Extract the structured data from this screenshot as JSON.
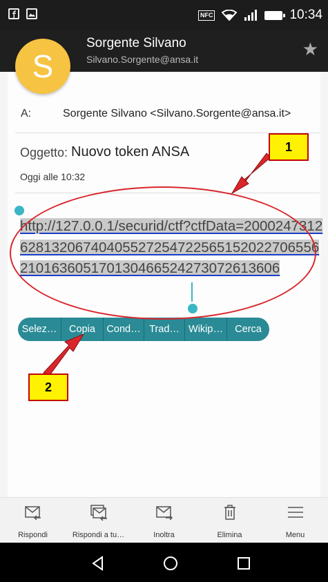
{
  "status_bar": {
    "time": "10:34",
    "nfc": "NFC"
  },
  "header": {
    "avatar_letter": "S",
    "sender_name": "Sorgente Silvano",
    "sender_email": "Silvano.Sorgente@ansa.it"
  },
  "email": {
    "to_label": "A:",
    "to_value": "Sorgente Silvano <Silvano.Sorgente@ansa.it>",
    "subject_label": "Oggetto:",
    "subject_value": "Nuovo token ANSA",
    "date": "Oggi alle 10:32",
    "link": "http://127.0.0.1/securid/ctf?ctfData=20002473126281320674040552725472256515202270655621016360517013046652427307261360​6"
  },
  "selection_toolbar": [
    "Selez…",
    "Copia",
    "Cond…",
    "Trad…",
    "Wikip…",
    "Cerca"
  ],
  "callouts": {
    "first": "1",
    "second": "2"
  },
  "bottom_bar": [
    {
      "label": "Rispondi",
      "icon": "reply-icon"
    },
    {
      "label": "Rispondi a tu…",
      "icon": "reply-all-icon"
    },
    {
      "label": "Inoltra",
      "icon": "forward-icon"
    },
    {
      "label": "Elimina",
      "icon": "trash-icon"
    },
    {
      "label": "Menu",
      "icon": "menu-icon"
    }
  ],
  "colors": {
    "accent": "#2a8b96",
    "handle": "#3cb5c4",
    "annotation_red": "#d9262c",
    "callout_yellow": "#fff200",
    "avatar": "#f6c342"
  }
}
